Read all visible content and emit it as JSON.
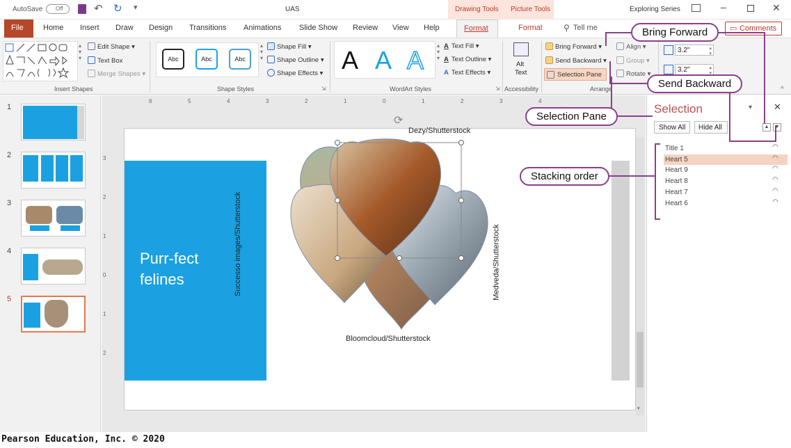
{
  "titlebar": {
    "autosave": "AutoSave",
    "autosave_state": "Off",
    "doc_title": "UAS",
    "context_drawing": "Drawing Tools",
    "context_picture": "Picture Tools",
    "account": "Exploring Series"
  },
  "tabs": [
    "File",
    "Home",
    "Insert",
    "Draw",
    "Design",
    "Transitions",
    "Animations",
    "Slide Show",
    "Review",
    "View",
    "Help",
    "Format",
    "Format"
  ],
  "tell_me": "Tell me",
  "comments": "Comments",
  "ribbon": {
    "insert_shapes": {
      "label": "Insert Shapes",
      "edit_shape": "Edit Shape",
      "text_box": "Text Box",
      "merge_shapes": "Merge Shapes"
    },
    "shape_styles": {
      "label": "Shape Styles",
      "swatch": "Abc",
      "fill": "Shape Fill",
      "outline": "Shape Outline",
      "effects": "Shape Effects"
    },
    "wordart": {
      "label": "WordArt Styles",
      "letter": "A",
      "fill": "Text Fill",
      "outline": "Text Outline",
      "effects": "Text Effects"
    },
    "accessibility": {
      "label": "Accessibility",
      "alt_text_1": "Alt",
      "alt_text_2": "Text"
    },
    "arrange": {
      "label": "Arrange",
      "bring_forward": "Bring Forward",
      "send_backward": "Send Backward",
      "selection_pane": "Selection Pane",
      "align": "Align",
      "group": "Group",
      "rotate": "Rotate"
    },
    "size": {
      "height": "3.2\"",
      "width": "3.2\""
    }
  },
  "slides": [
    {
      "num": "1"
    },
    {
      "num": "2"
    },
    {
      "num": "3"
    },
    {
      "num": "4"
    },
    {
      "num": "5"
    }
  ],
  "slide": {
    "title_line1": "Purr-fect",
    "title_line2": "felines",
    "credit_top": "Dezy/Shutterstock",
    "credit_left": "Successo images/Shutterstock",
    "credit_right": "Medveda/Shutterstock",
    "credit_bottom": "Bloomcloud/Shutterstock"
  },
  "ruler": {
    "h": [
      "6",
      "5",
      "4",
      "3",
      "2",
      "1",
      "0",
      "1",
      "2",
      "3",
      "4",
      "5",
      "6"
    ],
    "v": [
      "3",
      "2",
      "1",
      "0",
      "1",
      "2",
      "3"
    ]
  },
  "selection_pane": {
    "title": "Selection",
    "show_all": "Show All",
    "hide_all": "Hide All",
    "items": [
      "Title 1",
      "Heart 5",
      "Heart 9",
      "Heart 8",
      "Heart 7",
      "Heart 6"
    ],
    "selected_index": 1
  },
  "callouts": {
    "bring_forward": "Bring Forward",
    "send_backward": "Send Backward",
    "selection_pane": "Selection Pane",
    "stacking_order": "Stacking order"
  },
  "footer": "Pearson Education, Inc. © 2020",
  "colors": {
    "accent_red": "#b7472a",
    "blue_block": "#1ba1e2",
    "callout_border": "#8a3f8a",
    "selected_row": "#f5d3c2",
    "context_tab": "#d24726"
  }
}
